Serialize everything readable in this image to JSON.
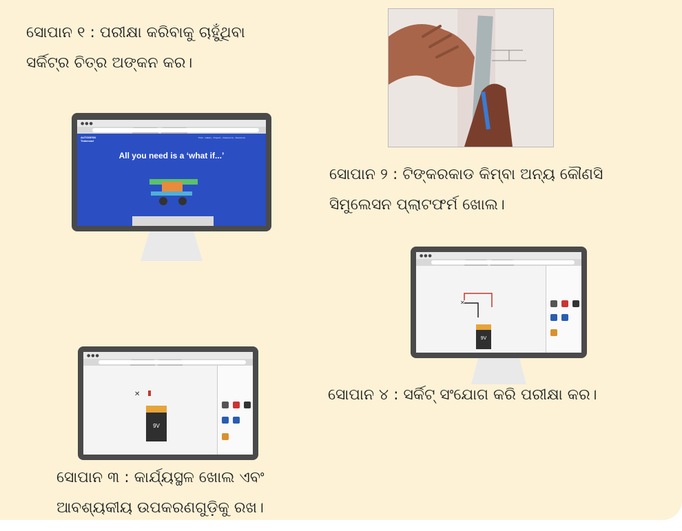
{
  "steps": {
    "step1": {
      "line1": "ସୋପାନ ୧ : ପରୀକ୍ଷା କରିବାକୁ ଚାହୁଁଥିବା",
      "line2": "ସର୍କିଟ୍‌ର ଚିତ୍ର ଅଙ୍କନ କର।"
    },
    "step2": {
      "line1": "ସୋପାନ ୨ : ଟିଙ୍କରକାଡ କିମ୍ବା ଅନ୍ୟ କୌଣସି",
      "line2": "ସିମୁଲେସନ ପ୍ଲାଟଫର୍ମ ଖୋଲ।"
    },
    "step3": {
      "line1": "ସୋପାନ ୩ : କାର୍ଯ୍ୟସ୍ଥଳ ଖୋଲ ଏବଂ",
      "line2": "ଆବଶ୍ୟକୀୟ ଉପକରଣଗୁଡ଼ିକୁ ରଖ।"
    },
    "step4": {
      "line1": "ସୋପାନ ୪ : ସର୍କିଟ୍ ସଂଯୋଗ କରି ପରୀକ୍ଷା କର।"
    }
  },
  "screen1": {
    "logo_line1": "AUTODESK",
    "logo_line2": "Tinkercad",
    "nav": "Think ·  Gallery  ·  Projects  ·  Classrooms  ·  Resources",
    "hero_text": "All you need is a ‘what if...’"
  },
  "battery_label": "9V",
  "colors": {
    "panel": "#fdf2d6",
    "hero": "#2b4fc2",
    "bezel": "#4a4a4a",
    "battery": "#2f2f2f",
    "battery_cap": "#e6a43a"
  }
}
